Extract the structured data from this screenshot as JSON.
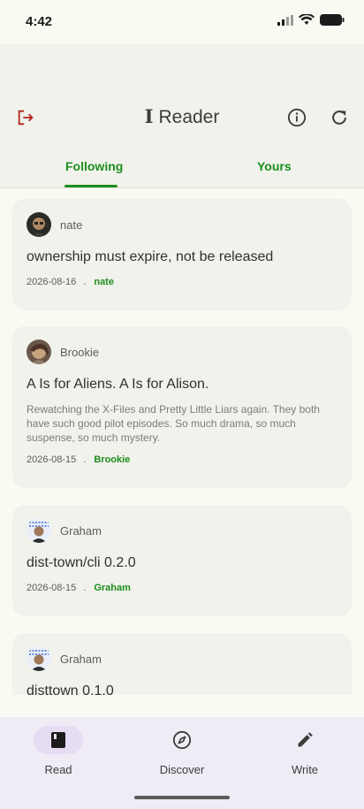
{
  "status_bar": {
    "time": "4:42"
  },
  "app_bar": {
    "title": "Reader",
    "title_glyph": "I",
    "icons": [
      "logout-icon",
      "info-icon",
      "refresh-icon"
    ],
    "logout_color": "#b3261e"
  },
  "tabs": [
    {
      "label": "Following",
      "selected": true
    },
    {
      "label": "Yours",
      "selected": false
    }
  ],
  "accent_color": "#1d8e1d",
  "posts": [
    {
      "author": "nate",
      "title": "ownership must expire, not be released",
      "excerpt": "",
      "date": "2026-08-16",
      "dot": ".",
      "author_link": "nate"
    },
    {
      "author": "Brookie",
      "title": "A Is for Aliens. A Is for Alison.",
      "excerpt": "Rewatching the X-Files and Pretty Little Liars again. They both have such good pilot episodes. So much drama, so much suspense, so much mystery.",
      "date": "2026-08-15",
      "dot": ".",
      "author_link": "Brookie"
    },
    {
      "author": "Graham",
      "title": "dist-town/cli 0.2.0",
      "excerpt": "",
      "date": "2026-08-15",
      "dot": ".",
      "author_link": "Graham"
    },
    {
      "author": "Graham",
      "title": "disttown 0.1.0",
      "excerpt": "",
      "date": "",
      "dot": "",
      "author_link": ""
    }
  ],
  "bottom_nav": [
    {
      "label": "Read",
      "icon": "book-icon",
      "active": true
    },
    {
      "label": "Discover",
      "icon": "compass-icon",
      "active": false
    },
    {
      "label": "Write",
      "icon": "pencil-icon",
      "active": false
    }
  ]
}
